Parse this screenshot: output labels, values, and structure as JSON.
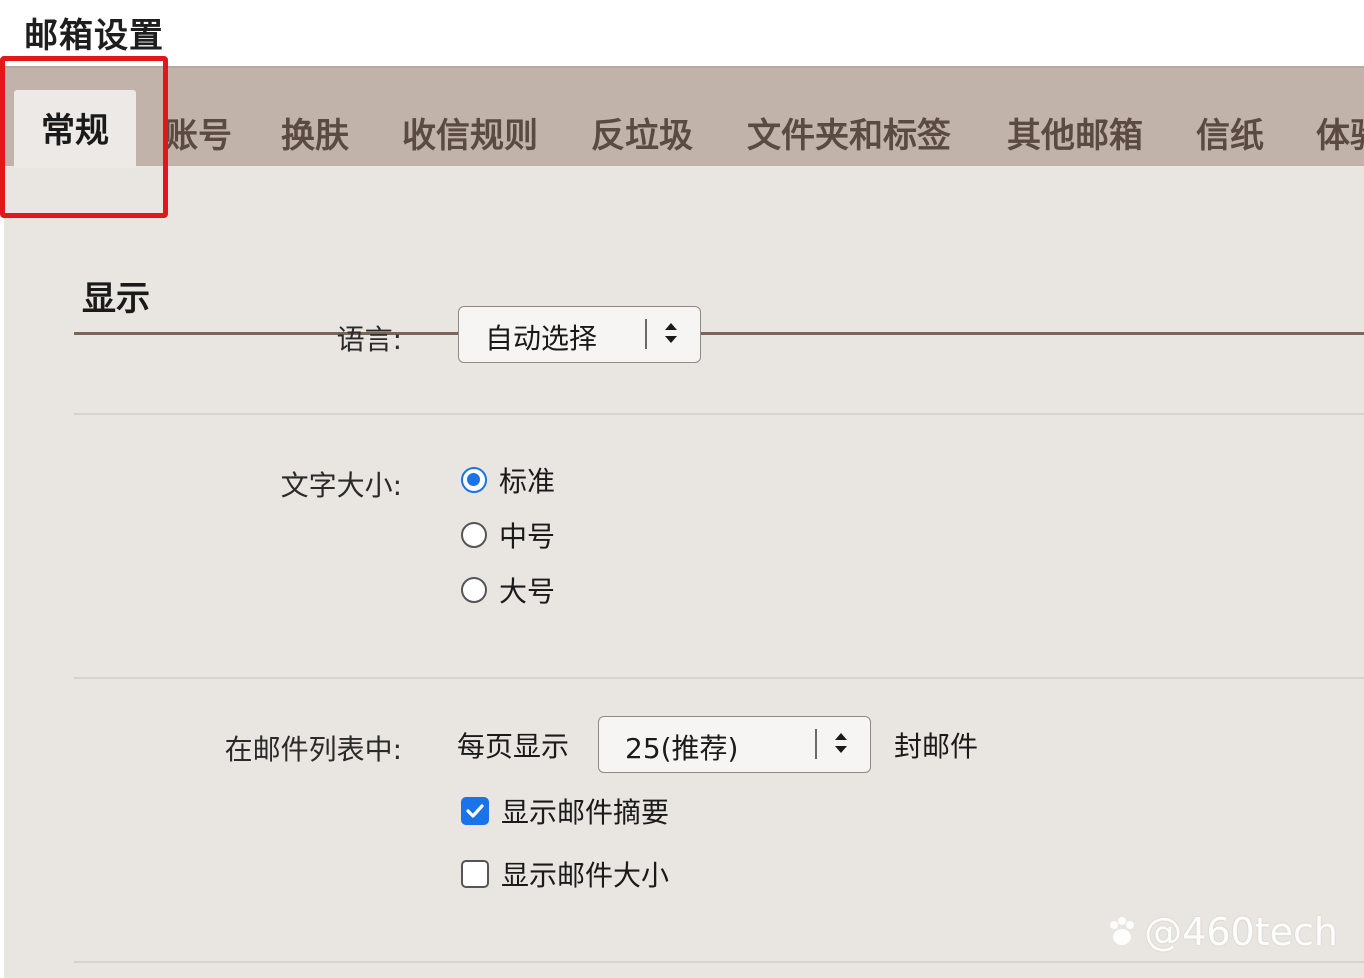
{
  "page_title": "邮箱设置",
  "tabs": [
    {
      "label": "常规",
      "active": true
    },
    {
      "label": "账号",
      "active": false
    },
    {
      "label": "换肤",
      "active": false
    },
    {
      "label": "收信规则",
      "active": false
    },
    {
      "label": "反垃圾",
      "active": false
    },
    {
      "label": "文件夹和标签",
      "active": false
    },
    {
      "label": "其他邮箱",
      "active": false
    },
    {
      "label": "信纸",
      "active": false
    },
    {
      "label": "体验",
      "active": false
    }
  ],
  "section": {
    "title": "显示"
  },
  "language": {
    "label": "语言:",
    "selected": "自动选择"
  },
  "font_size": {
    "label": "文字大小:",
    "options": [
      {
        "label": "标准",
        "checked": true
      },
      {
        "label": "中号",
        "checked": false
      },
      {
        "label": "大号",
        "checked": false
      }
    ]
  },
  "mail_list": {
    "label": "在邮件列表中:",
    "per_page_prefix": "每页显示",
    "per_page_selected": "25(推荐)",
    "per_page_suffix": "封邮件",
    "show_summary": {
      "label": "显示邮件摘要",
      "checked": true
    },
    "show_size": {
      "label": "显示邮件大小",
      "checked": false
    }
  },
  "watermark": {
    "text": "@460tech"
  },
  "colors": {
    "accent": "#1a73e8",
    "tab_bar": "#c1b3aa",
    "panel": "#e9e6e2",
    "highlight": "#e3161c"
  }
}
